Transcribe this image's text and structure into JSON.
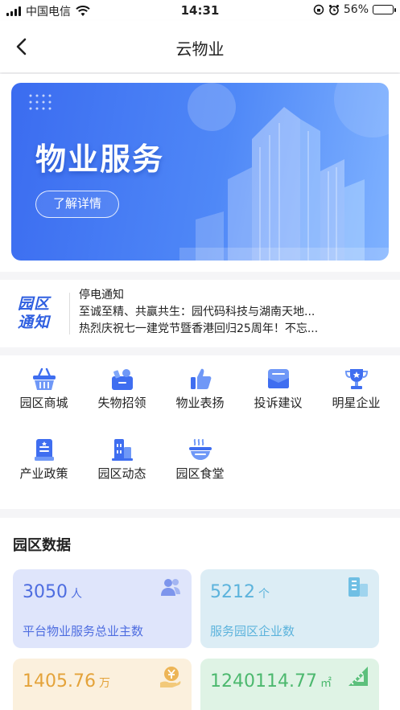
{
  "status_bar": {
    "carrier": "中国电信",
    "time": "14:31",
    "battery_percent": "56%",
    "battery_level": 0.56
  },
  "nav": {
    "title": "云物业"
  },
  "banner": {
    "title": "物业服务",
    "button_label": "了解详情"
  },
  "notice": {
    "logo_line1": "园区",
    "logo_line2": "通知",
    "items": [
      "停电通知",
      "至诚至精、共赢共生：园代码科技与湖南天地...",
      "热烈庆祝七一建党节暨香港回归25周年！不忘..."
    ]
  },
  "menu": {
    "items": [
      {
        "label": "园区商城",
        "icon": "basket-icon"
      },
      {
        "label": "失物招领",
        "icon": "lost-found-icon"
      },
      {
        "label": "物业表扬",
        "icon": "thumbs-up-icon"
      },
      {
        "label": "投诉建议",
        "icon": "mail-icon"
      },
      {
        "label": "明星企业",
        "icon": "trophy-icon"
      },
      {
        "label": "产业政策",
        "icon": "document-icon"
      },
      {
        "label": "园区动态",
        "icon": "buildings-icon"
      },
      {
        "label": "园区食堂",
        "icon": "bowl-icon"
      }
    ]
  },
  "park_data": {
    "title": "园区数据",
    "cards": [
      {
        "value": "3050",
        "unit": "人",
        "label": "平台物业服务总业主数",
        "icon": "users-icon",
        "bg": "#dfe5fb",
        "color": "#4e6de0"
      },
      {
        "value": "5212",
        "unit": "个",
        "label": "服务园区企业数",
        "icon": "building-icon",
        "bg": "#dcedf5",
        "color": "#5cb3dc"
      },
      {
        "value": "1405.76",
        "unit": "万",
        "label": "",
        "icon": "yuan-hand-icon",
        "bg": "#fbf0dd",
        "color": "#e4a33a"
      },
      {
        "value": "1240114.77",
        "unit": "㎡",
        "label": "",
        "icon": "ruler-icon",
        "bg": "#dff3e5",
        "color": "#4cb86e"
      }
    ]
  }
}
